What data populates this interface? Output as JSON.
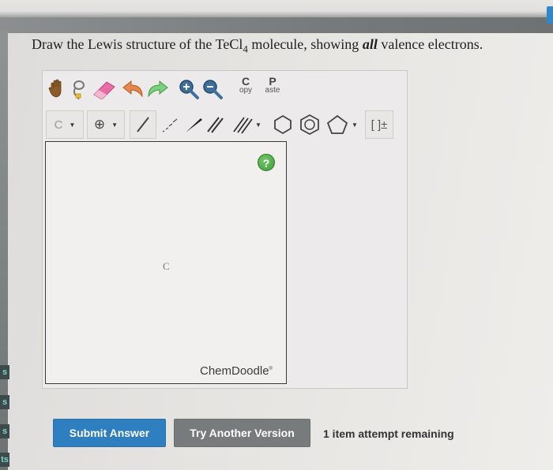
{
  "question": {
    "prefix": "Draw the Lewis structure of the TeCl",
    "subscript": "4",
    "middle": " molecule, showing ",
    "emphasis": "all",
    "suffix": " valence electrons."
  },
  "side_tabs": [
    "s",
    "s",
    "s",
    "ts"
  ],
  "toolbar": {
    "copy_letter": "C",
    "copy_rest": "opy",
    "paste_letter": "P",
    "paste_rest": "aste",
    "atom_label": "C",
    "charge_label": "⊕",
    "bracket_label": "[ ]±",
    "icons": [
      "hand-icon",
      "eraser-icon",
      "undo-icon",
      "redo-icon",
      "zoom-in-icon",
      "zoom-out-icon"
    ]
  },
  "canvas": {
    "atom_text": "C",
    "help_label": "?",
    "brand": "ChemDoodle",
    "brand_mark": "®"
  },
  "actions": {
    "submit_label": "Submit Answer",
    "try_label": "Try Another Version",
    "attempts_text": "1 item attempt remaining"
  },
  "colors": {
    "submit": "#2d7fc0",
    "try_another": "#777b7c",
    "help": "#4faa47"
  }
}
